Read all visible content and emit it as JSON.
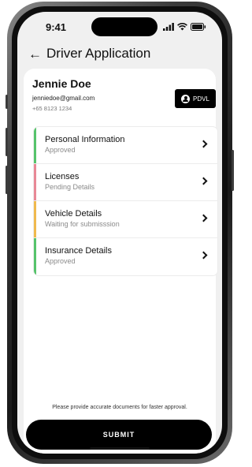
{
  "status_bar": {
    "time": "9:41"
  },
  "header": {
    "title": "Driver Application",
    "back_icon": "arrow-left-icon"
  },
  "profile": {
    "name": "Jennie Doe",
    "email": "jenniedoe@gmail.com",
    "phone": "+65 8123 1234",
    "badge_label": "PDVL",
    "badge_icon": "driver-icon"
  },
  "sections": [
    {
      "title": "Personal Information",
      "status": "Approved",
      "accent": "#56c36b"
    },
    {
      "title": "Licenses",
      "status": "Pending Details",
      "accent": "#e88896"
    },
    {
      "title": "Vehicle Details",
      "status": "Waiting for submisssion",
      "accent": "#f0b94d"
    },
    {
      "title": "Insurance Details",
      "status": "Approved",
      "accent": "#56c36b"
    }
  ],
  "footer": {
    "hint": "Please provide accurate documents for faster approval.",
    "submit_label": "SUBMIT"
  }
}
